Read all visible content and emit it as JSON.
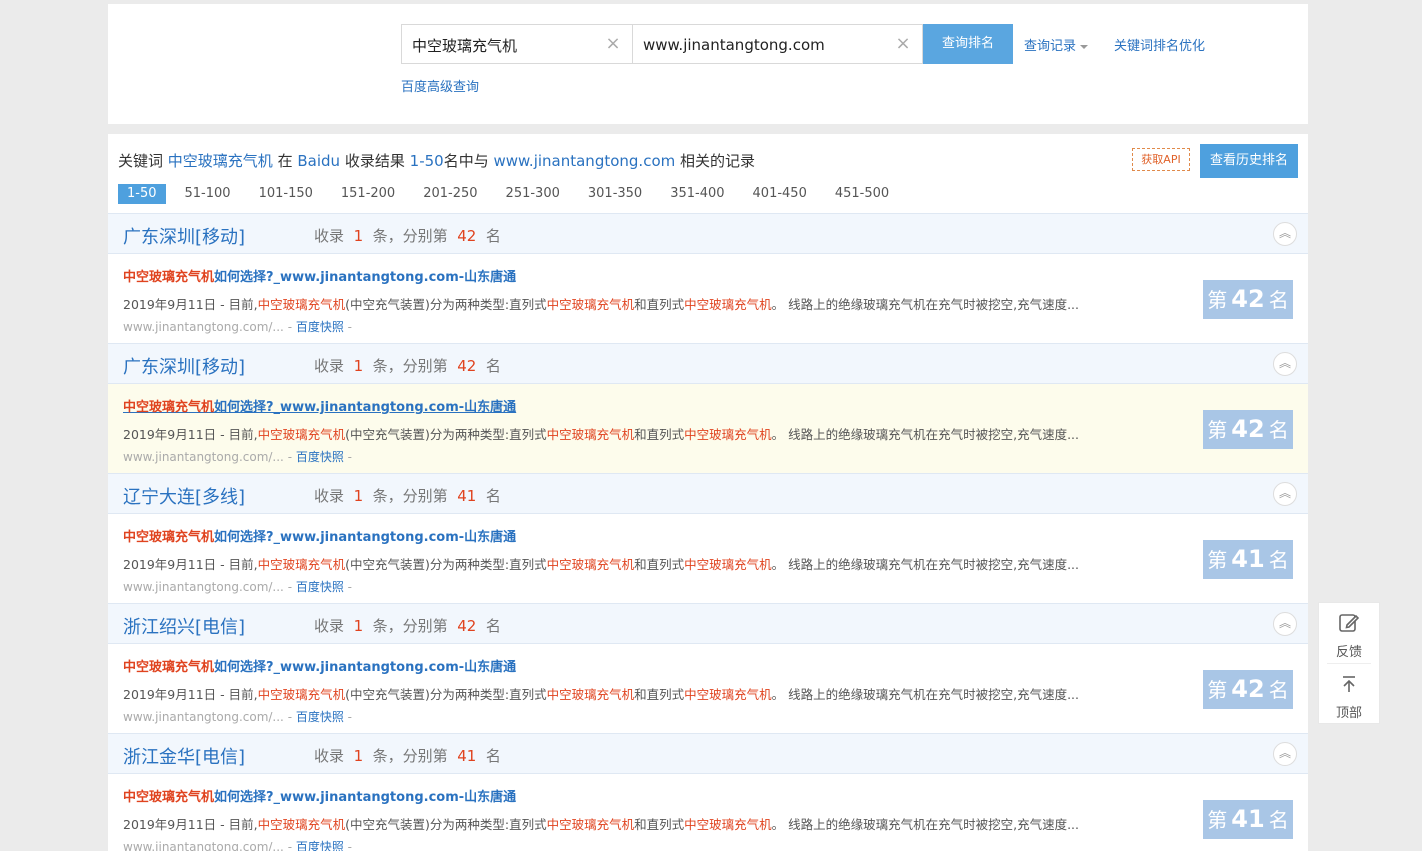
{
  "search": {
    "keyword": "中空玻璃充气机",
    "site": "www.jinantangtong.com",
    "clear_icon": "×",
    "query_button": "查询排名",
    "history_link": "查询记录",
    "optimize_link": "关键词排名优化",
    "advanced_link": "百度高级查询"
  },
  "summary": {
    "prefix": "关键词",
    "keyword": "中空玻璃充气机",
    "engine_prefix": "在",
    "engine": "Baidu",
    "middle": "收录结果",
    "range": "1-50",
    "range_suffix": "名中与",
    "site": "www.jinantangtong.com",
    "suffix": "相关的记录"
  },
  "actions": {
    "api_button": "获取API",
    "history_button": "查看历史排名"
  },
  "pages": [
    "1-50",
    "51-100",
    "101-150",
    "151-200",
    "201-250",
    "251-300",
    "301-350",
    "351-400",
    "401-450",
    "451-500"
  ],
  "groups": [
    {
      "region": "广东深圳[移动]",
      "count_pre": "收录",
      "count": "1",
      "count_mid": "条，分别第",
      "rank": "42",
      "count_post": "名",
      "title_kw": "中空玻璃充气机",
      "title_rest": "如何选择?_www.jinantangtong.com-山东唐通",
      "date": "2019年9月11日 - 目前,",
      "desc_kw1": "中空玻璃充气机",
      "desc_t1": "(中空充气装置)分为两种类型:直列式",
      "desc_kw2": "中空玻璃充气机",
      "desc_t2": "和直列式",
      "desc_kw3": "中空玻璃充气机",
      "desc_t3": "。 线路上的绝缘玻璃充气机在充气时被挖空,充气速度...",
      "url": "www.jinantangtong.com/...",
      "snapshot": "百度快照",
      "rank_pre": "第",
      "rank_post": "名"
    },
    {
      "region": "广东深圳[移动]",
      "count_pre": "收录",
      "count": "1",
      "count_mid": "条，分别第",
      "rank": "42",
      "count_post": "名",
      "title_kw": "中空玻璃充气机",
      "title_rest": "如何选择?_www.jinantangtong.com-山东唐通",
      "date": "2019年9月11日 - 目前,",
      "desc_kw1": "中空玻璃充气机",
      "desc_t1": "(中空充气装置)分为两种类型:直列式",
      "desc_kw2": "中空玻璃充气机",
      "desc_t2": "和直列式",
      "desc_kw3": "中空玻璃充气机",
      "desc_t3": "。 线路上的绝缘玻璃充气机在充气时被挖空,充气速度...",
      "url": "www.jinantangtong.com/...",
      "snapshot": "百度快照",
      "rank_pre": "第",
      "rank_post": "名"
    },
    {
      "region": "辽宁大连[多线]",
      "count_pre": "收录",
      "count": "1",
      "count_mid": "条，分别第",
      "rank": "41",
      "count_post": "名",
      "title_kw": "中空玻璃充气机",
      "title_rest": "如何选择?_www.jinantangtong.com-山东唐通",
      "date": "2019年9月11日 - 目前,",
      "desc_kw1": "中空玻璃充气机",
      "desc_t1": "(中空充气装置)分为两种类型:直列式",
      "desc_kw2": "中空玻璃充气机",
      "desc_t2": "和直列式",
      "desc_kw3": "中空玻璃充气机",
      "desc_t3": "。 线路上的绝缘玻璃充气机在充气时被挖空,充气速度...",
      "url": "www.jinantangtong.com/...",
      "snapshot": "百度快照",
      "rank_pre": "第",
      "rank_post": "名"
    },
    {
      "region": "浙江绍兴[电信]",
      "count_pre": "收录",
      "count": "1",
      "count_mid": "条，分别第",
      "rank": "42",
      "count_post": "名",
      "title_kw": "中空玻璃充气机",
      "title_rest": "如何选择?_www.jinantangtong.com-山东唐通",
      "date": "2019年9月11日 - 目前,",
      "desc_kw1": "中空玻璃充气机",
      "desc_t1": "(中空充气装置)分为两种类型:直列式",
      "desc_kw2": "中空玻璃充气机",
      "desc_t2": "和直列式",
      "desc_kw3": "中空玻璃充气机",
      "desc_t3": "。 线路上的绝缘玻璃充气机在充气时被挖空,充气速度...",
      "url": "www.jinantangtong.com/...",
      "snapshot": "百度快照",
      "rank_pre": "第",
      "rank_post": "名"
    },
    {
      "region": "浙江金华[电信]",
      "count_pre": "收录",
      "count": "1",
      "count_mid": "条，分别第",
      "rank": "41",
      "count_post": "名",
      "title_kw": "中空玻璃充气机",
      "title_rest": "如何选择?_www.jinantangtong.com-山东唐通",
      "date": "2019年9月11日 - 目前,",
      "desc_kw1": "中空玻璃充气机",
      "desc_t1": "(中空充气装置)分为两种类型:直列式",
      "desc_kw2": "中空玻璃充气机",
      "desc_t2": "和直列式",
      "desc_kw3": "中空玻璃充气机",
      "desc_t3": "。 线路上的绝缘玻璃充气机在充气时被挖空,充气速度...",
      "url": "www.jinantangtong.com/...",
      "snapshot": "百度快照",
      "rank_pre": "第",
      "rank_post": "名"
    }
  ],
  "float_bar": {
    "feedback": "反馈",
    "top": "顶部"
  },
  "icons": {
    "clear": "clear-x-icon",
    "caret": "caret-down-icon",
    "collapse": "chevron-up-icon",
    "feedback": "edit-icon",
    "top": "arrow-up-icon"
  },
  "colors": {
    "accent": "#4ea0de",
    "link": "#2a72c0",
    "keyword": "#e0431f",
    "rank_badge": "#a9c6e6",
    "highlight_row": "#fdfcec"
  },
  "active_page": "1-50",
  "highlighted_group": 1
}
